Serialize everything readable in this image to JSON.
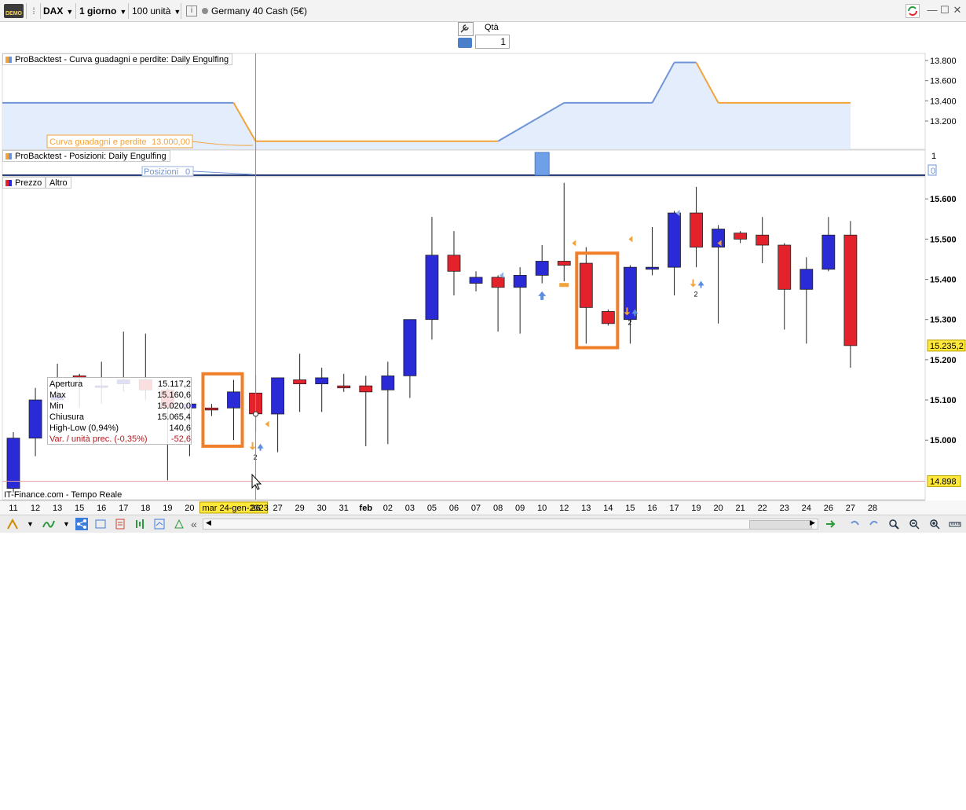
{
  "toolbar": {
    "badge": "DEMO",
    "instrument": "DAX",
    "timeframe": "1 giorno",
    "units": "100 unità",
    "info_icon": "i",
    "market": "Germany 40 Cash (5€)",
    "icons": [
      "demo-icon",
      "grip-icon",
      "info-icon",
      "refresh-icon",
      "minimize-icon",
      "restore-icon",
      "close-icon"
    ]
  },
  "order": {
    "qty_label": "Qtà",
    "qty_value": "1"
  },
  "panels": {
    "equity_label": "ProBacktest - Curva guadagni e perdite: Daily Engulfing",
    "equity_tag_label": "Curva guadagni e perdite",
    "equity_tag_value": "13.000,00",
    "positions_label": "ProBacktest - Posizioni: Daily Engulfing",
    "positions_tag_label": "Posizioni",
    "positions_tag_value": "0",
    "price_tab": "Prezzo",
    "other_tab": "Altro",
    "source": "IT-Finance.com - Tempo Reale"
  },
  "tooltip": {
    "rows": [
      {
        "key": "Apertura",
        "value": "15.117,2"
      },
      {
        "key": "Max",
        "value": "15.160,6"
      },
      {
        "key": "Min",
        "value": "15.020,0"
      },
      {
        "key": "Chiusura",
        "value": "15.065,4"
      },
      {
        "key": "High-Low (0,94%)",
        "value": "140,6"
      },
      {
        "key": "Var. / unità prec. (-0,35%)",
        "value": "-52,6"
      }
    ]
  },
  "colors": {
    "up": "#2a2ad6",
    "down": "#e3222c",
    "equity": "#6f95d8",
    "equity_flat": "#f2a33a",
    "highlight": "#f07f2a",
    "cursor": "#e36b6b"
  },
  "chart_data": [
    {
      "type": "area",
      "y_ticks": [
        "13.800",
        "13.600",
        "13.400",
        "13.200"
      ],
      "y_range": [
        12920,
        13870
      ],
      "series": [
        {
          "name": "Curva guadagni e perdite",
          "points": [
            [
              "11",
              13380
            ],
            [
              "22",
              13380
            ],
            [
              "24",
              13000
            ],
            [
              "07",
              13000
            ],
            [
              "09",
              13380
            ],
            [
              "13",
              13380
            ],
            [
              "15",
              13780
            ],
            [
              "16",
              13780
            ],
            [
              "17",
              13380
            ],
            [
              "24",
              13380
            ]
          ]
        }
      ]
    },
    {
      "type": "bar",
      "y_ticks": [
        "1",
        "0"
      ],
      "series": [
        {
          "name": "Posizioni",
          "points": [
            [
              "08",
              1
            ]
          ]
        }
      ]
    },
    {
      "type": "bar",
      "subtype": "candlestick",
      "x_tick_labels": [
        "11",
        "12",
        "13",
        "15",
        "16",
        "17",
        "18",
        "19",
        "20",
        "22",
        "mar 24-gen-2023",
        "26",
        "27",
        "29",
        "30",
        "31",
        "feb",
        "02",
        "03",
        "05",
        "06",
        "07",
        "08",
        "09",
        "10",
        "12",
        "13",
        "14",
        "15",
        "16",
        "17",
        "19",
        "20",
        "21",
        "22",
        "23",
        "24",
        "26",
        "27",
        "28"
      ],
      "cursor_label": "mar 24-gen-2023",
      "y_ticks": [
        "15.600",
        "15.500",
        "15.400",
        "15.300",
        "15.200",
        "15.100",
        "15.000"
      ],
      "last_price": "15.235,2",
      "cursor_price": "14.898",
      "y_range": [
        14852,
        15655
      ],
      "candles": [
        {
          "x": "11",
          "o": 14880,
          "h": 15020,
          "l": 14870,
          "c": 15005
        },
        {
          "x": "12",
          "o": 15005,
          "h": 15130,
          "l": 14960,
          "c": 15100
        },
        {
          "x": "13",
          "o": 15100,
          "h": 15190,
          "l": 15070,
          "c": 15110
        },
        {
          "x": "15",
          "o": 15160,
          "h": 15165,
          "l": 15080,
          "c": 15155
        },
        {
          "x": "16",
          "o": 15135,
          "h": 15195,
          "l": 15090,
          "c": 15135
        },
        {
          "x": "17",
          "o": 15140,
          "h": 15270,
          "l": 15120,
          "c": 15150
        },
        {
          "x": "18",
          "o": 15150,
          "h": 15265,
          "l": 15100,
          "c": 15125
        },
        {
          "x": "19",
          "o": 15125,
          "h": 15130,
          "l": 14900,
          "c": 15080
        },
        {
          "x": "20",
          "o": 15080,
          "h": 15140,
          "l": 14960,
          "c": 15090
        },
        {
          "x": "22",
          "o": 15080,
          "h": 15090,
          "l": 15060,
          "c": 15075
        },
        {
          "x": "23",
          "o": 15080,
          "h": 15150,
          "l": 15000,
          "c": 15120
        },
        {
          "x": "24",
          "o": 15117.2,
          "h": 15160.6,
          "l": 15020.0,
          "c": 15065.4
        },
        {
          "x": "25",
          "o": 15065,
          "h": 15155,
          "l": 14970,
          "c": 15155
        },
        {
          "x": "26",
          "o": 15150,
          "h": 15215,
          "l": 15070,
          "c": 15140
        },
        {
          "x": "27",
          "o": 15140,
          "h": 15180,
          "l": 15070,
          "c": 15155
        },
        {
          "x": "29",
          "o": 15135,
          "h": 15165,
          "l": 15120,
          "c": 15130
        },
        {
          "x": "30",
          "o": 15135,
          "h": 15160,
          "l": 14985,
          "c": 15120
        },
        {
          "x": "31",
          "o": 15125,
          "h": 15195,
          "l": 14990,
          "c": 15160
        },
        {
          "x": "feb",
          "o": 15160,
          "h": 15300,
          "l": 15105,
          "c": 15300
        },
        {
          "x": "02",
          "o": 15300,
          "h": 15555,
          "l": 15250,
          "c": 15460
        },
        {
          "x": "03",
          "o": 15460,
          "h": 15520,
          "l": 15360,
          "c": 15420
        },
        {
          "x": "05",
          "o": 15390,
          "h": 15420,
          "l": 15370,
          "c": 15405
        },
        {
          "x": "06",
          "o": 15405,
          "h": 15410,
          "l": 15270,
          "c": 15380
        },
        {
          "x": "07",
          "o": 15380,
          "h": 15430,
          "l": 15265,
          "c": 15410
        },
        {
          "x": "08",
          "o": 15410,
          "h": 15485,
          "l": 15390,
          "c": 15445
        },
        {
          "x": "09",
          "o": 15445,
          "h": 15640,
          "l": 15395,
          "c": 15435
        },
        {
          "x": "10",
          "o": 15440,
          "h": 15480,
          "l": 15240,
          "c": 15330
        },
        {
          "x": "12",
          "o": 15320,
          "h": 15325,
          "l": 15285,
          "c": 15290
        },
        {
          "x": "13",
          "o": 15300,
          "h": 15435,
          "l": 15240,
          "c": 15430
        },
        {
          "x": "14",
          "o": 15425,
          "h": 15530,
          "l": 15410,
          "c": 15430
        },
        {
          "x": "15",
          "o": 15430,
          "h": 15570,
          "l": 15360,
          "c": 15565
        },
        {
          "x": "16",
          "o": 15565,
          "h": 15630,
          "l": 15430,
          "c": 15480
        },
        {
          "x": "17",
          "o": 15480,
          "h": 15535,
          "l": 15290,
          "c": 15525
        },
        {
          "x": "19",
          "o": 15515,
          "h": 15520,
          "l": 15490,
          "c": 15500
        },
        {
          "x": "20",
          "o": 15510,
          "h": 15555,
          "l": 15440,
          "c": 15485
        },
        {
          "x": "21",
          "o": 15485,
          "h": 15490,
          "l": 15275,
          "c": 15375
        },
        {
          "x": "22",
          "o": 15375,
          "h": 15455,
          "l": 15240,
          "c": 15425
        },
        {
          "x": "23",
          "o": 15425,
          "h": 15555,
          "l": 15420,
          "c": 15510
        },
        {
          "x": "24",
          "o": 15510,
          "h": 15545,
          "l": 15180,
          "c": 15235.2
        }
      ]
    }
  ]
}
